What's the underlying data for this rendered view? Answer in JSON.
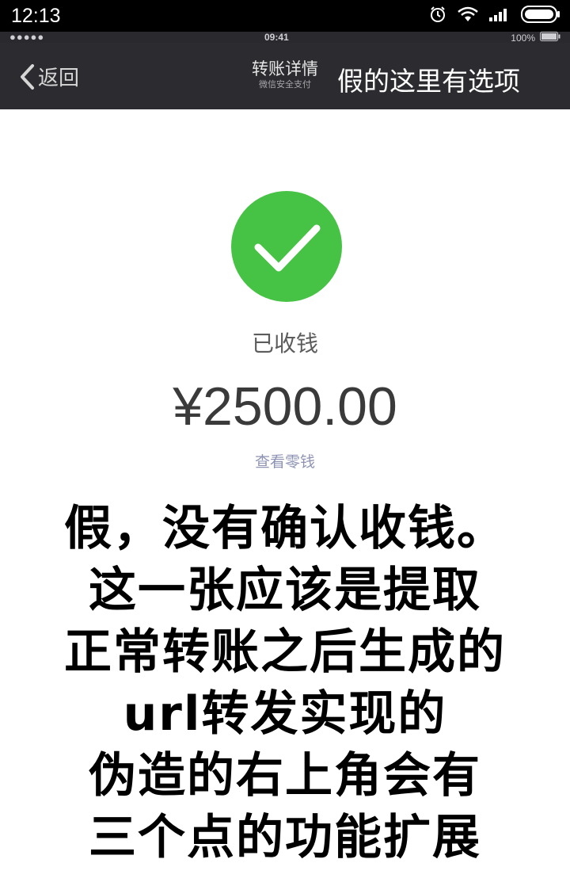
{
  "outer_status": {
    "time": "12:13",
    "icons": [
      "alarm-icon",
      "wifi-icon",
      "signal-icon",
      "battery-icon"
    ]
  },
  "inner_status": {
    "carrier_dots": "●●●●●",
    "time": "09:41",
    "battery": "100%"
  },
  "navbar": {
    "back_label": "返回",
    "title": "转账详情",
    "subtitle": "微信安全支付",
    "overlay_note": "假的这里有选项"
  },
  "transfer": {
    "status": "已收钱",
    "amount": "¥2500.00",
    "view_change_link": "查看零钱"
  },
  "caption_lines": [
    "假，没有确认收钱。",
    "这一张应该是提取",
    "正常转账之后生成的",
    "url转发实现的",
    "伪造的右上角会有",
    "三个点的功能扩展"
  ],
  "colors": {
    "success_green": "#46c245",
    "navbar_bg": "#2c2c30",
    "link_color": "#8e93b3"
  }
}
